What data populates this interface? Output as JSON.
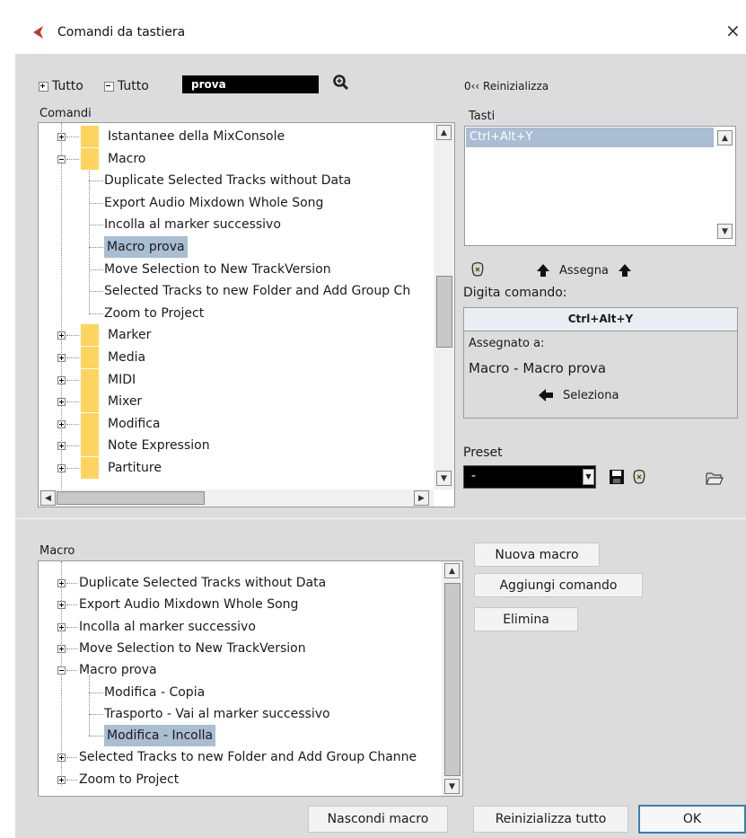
{
  "window": {
    "title": "Comandi da tastiera",
    "close_label": "×"
  },
  "top_controls": {
    "expand_all": "Tutto",
    "collapse_all": "Tutto",
    "search_value": "prova",
    "reset_label": "0‹‹ Reinizializza"
  },
  "commands": {
    "header": "Comandi",
    "rows": [
      {
        "label": "Istantanee della MixConsole",
        "folder": true,
        "expanded": false,
        "level": 0
      },
      {
        "label": "Macro",
        "folder": true,
        "expanded": true,
        "level": 0
      },
      {
        "label": "Duplicate Selected Tracks without Data",
        "level": 1
      },
      {
        "label": "Export Audio Mixdown Whole Song",
        "level": 1
      },
      {
        "label": "Incolla al marker successivo",
        "level": 1
      },
      {
        "label": "Macro prova",
        "level": 1,
        "selected": true
      },
      {
        "label": "Move Selection to New TrackVersion",
        "level": 1
      },
      {
        "label": "Selected Tracks to new Folder and Add Group Ch",
        "level": 1
      },
      {
        "label": "Zoom to Project",
        "level": 1
      },
      {
        "label": "Marker",
        "folder": true,
        "expanded": false,
        "level": 0
      },
      {
        "label": "Media",
        "folder": true,
        "expanded": false,
        "level": 0
      },
      {
        "label": "MIDI",
        "folder": true,
        "expanded": false,
        "level": 0
      },
      {
        "label": "Mixer",
        "folder": true,
        "expanded": false,
        "level": 0
      },
      {
        "label": "Modifica",
        "folder": true,
        "expanded": false,
        "level": 0
      },
      {
        "label": "Note Expression",
        "folder": true,
        "expanded": false,
        "level": 0
      },
      {
        "label": "Partiture",
        "folder": true,
        "expanded": false,
        "level": 0
      }
    ]
  },
  "keys": {
    "header": "Tasti",
    "items": [
      "Ctrl+Alt+Y"
    ],
    "assign_label": "Assegna",
    "type_command_label": "Digita comando:",
    "typed_value": "Ctrl+Alt+Y",
    "assigned_to_label": "Assegnato a:",
    "assigned_value": "Macro - Macro prova",
    "select_label": "Seleziona"
  },
  "preset": {
    "label": "Preset",
    "value": "-"
  },
  "macro": {
    "header": "Macro",
    "rows": [
      {
        "label": "Duplicate Selected Tracks without Data",
        "level": 0,
        "expanded": false
      },
      {
        "label": "Export Audio Mixdown Whole Song",
        "level": 0,
        "expanded": false
      },
      {
        "label": "Incolla al marker successivo",
        "level": 0,
        "expanded": false
      },
      {
        "label": "Move Selection to New TrackVersion",
        "level": 0,
        "expanded": false
      },
      {
        "label": "Macro prova",
        "level": 0,
        "expanded": true
      },
      {
        "label": "Modifica - Copia",
        "level": 1
      },
      {
        "label": "Trasporto - Vai al marker successivo",
        "level": 1
      },
      {
        "label": "Modifica - Incolla",
        "level": 1,
        "selected": true
      },
      {
        "label": "Selected Tracks to new Folder and Add Group Channe",
        "level": 0,
        "expanded": false
      },
      {
        "label": "Zoom to Project",
        "level": 0,
        "expanded": false
      }
    ],
    "new_macro": "Nuova macro",
    "add_command": "Aggiungi comando",
    "delete": "Elimina"
  },
  "footer": {
    "hide_macro": "Nascondi macro",
    "reset_all": "Reinizializza tutto",
    "ok": "OK"
  },
  "colors": {
    "selection": "#a9bdd3",
    "folder": "#ffd45e",
    "panel_bg": "#dcdcdc",
    "ok_border": "#3c7fb1",
    "accent_red": "#c0392b"
  }
}
